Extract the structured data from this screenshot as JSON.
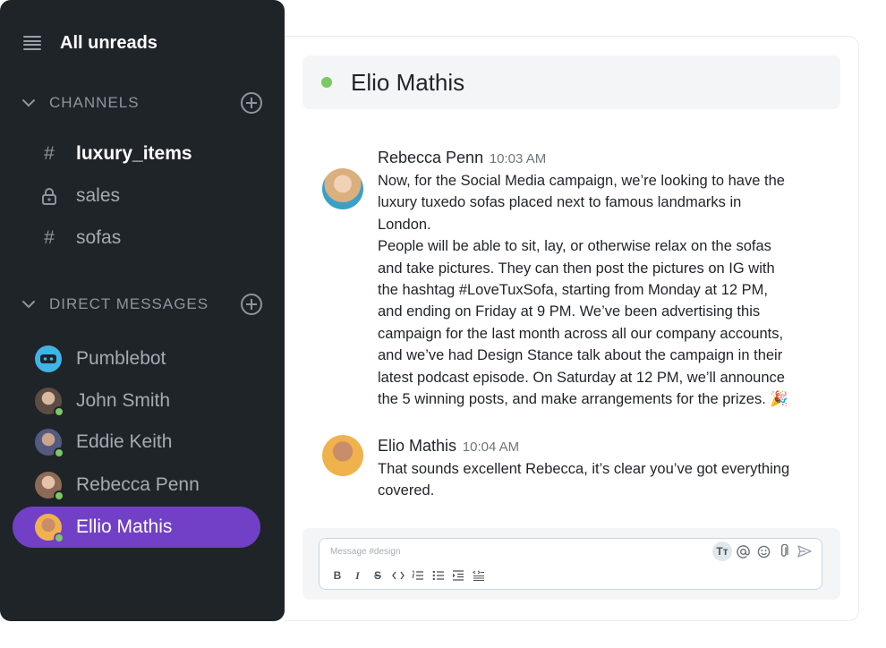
{
  "sidebar": {
    "all_unreads": "All unreads",
    "channels": {
      "title": "CHANNELS",
      "items": [
        {
          "symbol": "#",
          "name": "luxury_items"
        },
        {
          "symbol": "lock",
          "name": "sales"
        },
        {
          "symbol": "#",
          "name": "sofas"
        }
      ]
    },
    "direct_messages": {
      "title": "DIRECT MESSAGES",
      "items": [
        {
          "name": "Pumblebot",
          "avatar_color": "#3fb4e6"
        },
        {
          "name": "John Smith",
          "avatar_color": "#8a7a6e"
        },
        {
          "name": "Eddie Keith",
          "avatar_color": "#6b6f9a"
        },
        {
          "name": "Rebecca Penn",
          "avatar_color": "#b08a74"
        },
        {
          "name": "Ellio Mathis",
          "avatar_color": "#e8a94a"
        }
      ]
    }
  },
  "chat": {
    "title": "Elio Mathis",
    "messages": [
      {
        "author": "Rebecca Penn",
        "time": "10:03 AM",
        "lines": [
          "Now, for the Social Media campaign, we’re looking to have the",
          "luxury tuxedo sofas placed next to famous landmarks in",
          "London.",
          "People will be able to sit, lay, or otherwise relax on the sofas",
          "and take pictures. They can then post the pictures on IG with",
          "the hashtag #LoveTuxSofa, starting from Monday at 12 PM,",
          "and ending on Friday at 9 PM. We’ve been advertising this",
          "campaign for the last month across all our company accounts,",
          "and we’ve had Design Stance talk about the campaign in their",
          "latest podcast episode. On Saturday at 12 PM, we’ll announce",
          "the 5 winning posts, and make arrangements for the prizes. 🎉"
        ]
      },
      {
        "author": "Elio Mathis",
        "time": "10:04 AM",
        "lines": [
          "That sounds excellent Rebecca, it’s clear you’ve got everything",
          "covered."
        ]
      }
    ],
    "composer": {
      "placeholder": "Message #design",
      "format_label": "Tт"
    }
  },
  "colors": {
    "sidebar_bg": "#1f2429",
    "active_item": "#7140c6",
    "online": "#7cc862"
  }
}
